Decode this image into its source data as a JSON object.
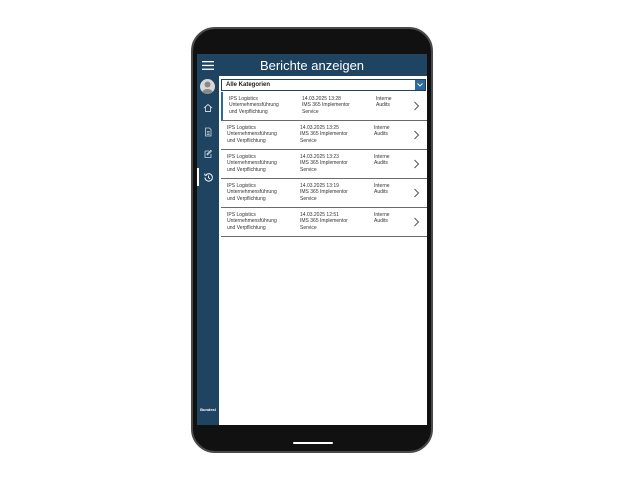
{
  "header": {
    "title": "Berichte anzeigen"
  },
  "filter": {
    "selected": "Alle Kategorien"
  },
  "sidebar": {
    "items": [
      {
        "icon": "home-icon"
      },
      {
        "icon": "document-icon"
      },
      {
        "icon": "edit-icon"
      },
      {
        "icon": "history-icon",
        "active": true
      }
    ],
    "brand": "Bundesl"
  },
  "reports": [
    {
      "company": "IPS Logistics",
      "subject1": "Unternehmensführung",
      "subject2": "und Verpflichtung",
      "datetime": "14.03.2025 13:28",
      "service1": "IMS 365 Implementor",
      "service2": "Service",
      "type1": "Interne",
      "type2": "Audits"
    },
    {
      "company": "IPS Logistics",
      "subject1": "Unternehmensführung",
      "subject2": "und Verpflichtung",
      "datetime": "14.03.2025 13:25",
      "service1": "IMS 365 Implementor",
      "service2": "Service",
      "type1": "Interne",
      "type2": "Audits"
    },
    {
      "company": "IPS Logistics",
      "subject1": "Unternehmensführung",
      "subject2": "und Verpflichtung",
      "datetime": "14.03.2025 13:23",
      "service1": "IMS 365 Implementor",
      "service2": "Service",
      "type1": "Interne",
      "type2": "Audits"
    },
    {
      "company": "IPS Logistics",
      "subject1": "Unternehmensführung",
      "subject2": "und Verpflichtung",
      "datetime": "14.03.2025 13:19",
      "service1": "IMS 365 Implementor",
      "service2": "Service",
      "type1": "Interne",
      "type2": "Audits"
    },
    {
      "company": "IPS Logistics",
      "subject1": "Unternehmensführung",
      "subject2": "und Verpflichtung",
      "datetime": "14.03.2025 12:51",
      "service1": "IMS 365 Implementor",
      "service2": "Service",
      "type1": "Interne",
      "type2": "Audits"
    }
  ],
  "colors": {
    "primary": "#1e4462",
    "accent": "#2b6a9a",
    "frame": "#111111"
  }
}
